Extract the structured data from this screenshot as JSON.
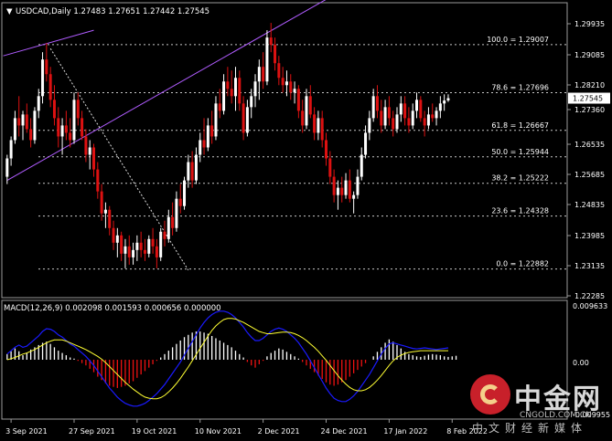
{
  "header": {
    "menu_glyph": "▼",
    "symbol_line": "USDCAD,Daily  1.27483 1.27651 1.27442 1.27545",
    "macd_line": "MACD(12,26,9) 0.002098 0.001593 0.000656 0.000000"
  },
  "colors": {
    "background": "#000000",
    "bull": "#ffffff",
    "bear": "#dd1111",
    "trendline": "#b05cff",
    "fib_line": "#c8c8c8",
    "macd_line": "#1a1aff",
    "signal_line": "#ffff33",
    "hist_pos": "#ffffff",
    "hist_neg": "#ee1111"
  },
  "chart_data": {
    "type": "candlestick",
    "symbol": "USDCAD",
    "timeframe": "Daily",
    "last_price_label": "1.27545",
    "ylim": [
      1.221,
      1.3015
    ],
    "price_ticks": [
      "1.29935",
      "1.29085",
      "1.28210",
      "1.27360",
      "1.26535",
      "1.25685",
      "1.24835",
      "1.23985",
      "1.23135",
      "1.22285"
    ],
    "x_ticks": [
      "3 Sep 2021",
      "27 Sep 2021",
      "19 Oct 2021",
      "10 Nov 2021",
      "2 Dec 2021",
      "24 Dec 2021",
      "17 Jan 2022",
      "8 Feb 2022"
    ],
    "x_tick_index": [
      1,
      17,
      33,
      49,
      65,
      81,
      97,
      113
    ],
    "candles": [
      [
        1.254,
        1.26,
        1.252,
        1.259
      ],
      [
        1.259,
        1.265,
        1.257,
        1.264
      ],
      [
        1.264,
        1.272,
        1.263,
        1.27
      ],
      [
        1.27,
        1.276,
        1.265,
        1.268
      ],
      [
        1.268,
        1.272,
        1.264,
        1.271
      ],
      [
        1.271,
        1.274,
        1.266,
        1.267
      ],
      [
        1.267,
        1.27,
        1.262,
        1.264
      ],
      [
        1.264,
        1.273,
        1.263,
        1.272
      ],
      [
        1.272,
        1.278,
        1.27,
        1.276
      ],
      [
        1.276,
        1.288,
        1.274,
        1.286
      ],
      [
        1.286,
        1.2905,
        1.28,
        1.282
      ],
      [
        1.282,
        1.284,
        1.273,
        1.275
      ],
      [
        1.275,
        1.279,
        1.268,
        1.27
      ],
      [
        1.27,
        1.273,
        1.262,
        1.265
      ],
      [
        1.265,
        1.27,
        1.26,
        1.268
      ],
      [
        1.268,
        1.272,
        1.264,
        1.266
      ],
      [
        1.266,
        1.27,
        1.262,
        1.264
      ],
      [
        1.264,
        1.277,
        1.263,
        1.275
      ],
      [
        1.275,
        1.277,
        1.268,
        1.27
      ],
      [
        1.27,
        1.272,
        1.264,
        1.265
      ],
      [
        1.265,
        1.267,
        1.258,
        1.26
      ],
      [
        1.26,
        1.264,
        1.256,
        1.262
      ],
      [
        1.262,
        1.263,
        1.254,
        1.256
      ],
      [
        1.256,
        1.258,
        1.248,
        1.25
      ],
      [
        1.25,
        1.252,
        1.242,
        1.244
      ],
      [
        1.244,
        1.247,
        1.24,
        1.245
      ],
      [
        1.245,
        1.246,
        1.238,
        1.24
      ],
      [
        1.24,
        1.242,
        1.234,
        1.236
      ],
      [
        1.236,
        1.24,
        1.232,
        1.238
      ],
      [
        1.238,
        1.239,
        1.231,
        1.233
      ],
      [
        1.233,
        1.237,
        1.229,
        1.235
      ],
      [
        1.235,
        1.238,
        1.23,
        1.232
      ],
      [
        1.232,
        1.236,
        1.23,
        1.234
      ],
      [
        1.234,
        1.238,
        1.231,
        1.236
      ],
      [
        1.236,
        1.239,
        1.232,
        1.234
      ],
      [
        1.234,
        1.237,
        1.231,
        1.233
      ],
      [
        1.233,
        1.238,
        1.232,
        1.237
      ],
      [
        1.237,
        1.24,
        1.233,
        1.235
      ],
      [
        1.235,
        1.237,
        1.229,
        1.232
      ],
      [
        1.232,
        1.24,
        1.231,
        1.239
      ],
      [
        1.239,
        1.242,
        1.235,
        1.237
      ],
      [
        1.237,
        1.245,
        1.236,
        1.243
      ],
      [
        1.243,
        1.247,
        1.238,
        1.24
      ],
      [
        1.24,
        1.25,
        1.239,
        1.248
      ],
      [
        1.248,
        1.252,
        1.244,
        1.246
      ],
      [
        1.246,
        1.254,
        1.245,
        1.253
      ],
      [
        1.253,
        1.26,
        1.251,
        1.258
      ],
      [
        1.258,
        1.261,
        1.251,
        1.253
      ],
      [
        1.253,
        1.262,
        1.252,
        1.26
      ],
      [
        1.26,
        1.266,
        1.258,
        1.264
      ],
      [
        1.264,
        1.27,
        1.26,
        1.262
      ],
      [
        1.262,
        1.27,
        1.261,
        1.268
      ],
      [
        1.268,
        1.272,
        1.263,
        1.265
      ],
      [
        1.265,
        1.276,
        1.264,
        1.274
      ],
      [
        1.274,
        1.278,
        1.27,
        1.272
      ],
      [
        1.272,
        1.282,
        1.271,
        1.28
      ],
      [
        1.28,
        1.284,
        1.276,
        1.278
      ],
      [
        1.278,
        1.283,
        1.274,
        1.276
      ],
      [
        1.276,
        1.284,
        1.272,
        1.281
      ],
      [
        1.281,
        1.283,
        1.272,
        1.274
      ],
      [
        1.274,
        1.276,
        1.264,
        1.266
      ],
      [
        1.266,
        1.275,
        1.265,
        1.273
      ],
      [
        1.273,
        1.278,
        1.27,
        1.276
      ],
      [
        1.276,
        1.282,
        1.273,
        1.28
      ],
      [
        1.28,
        1.286,
        1.275,
        1.284
      ],
      [
        1.284,
        1.288,
        1.278,
        1.28
      ],
      [
        1.28,
        1.294,
        1.279,
        1.292
      ],
      [
        1.292,
        1.296,
        1.288,
        1.29
      ],
      [
        1.29,
        1.292,
        1.283,
        1.285
      ],
      [
        1.285,
        1.287,
        1.279,
        1.281
      ],
      [
        1.281,
        1.284,
        1.277,
        1.279
      ],
      [
        1.279,
        1.283,
        1.276,
        1.28
      ],
      [
        1.28,
        1.282,
        1.275,
        1.277
      ],
      [
        1.277,
        1.28,
        1.274,
        1.278
      ],
      [
        1.278,
        1.279,
        1.27,
        1.272
      ],
      [
        1.272,
        1.275,
        1.266,
        1.268
      ],
      [
        1.268,
        1.278,
        1.267,
        1.276
      ],
      [
        1.276,
        1.279,
        1.27,
        1.271
      ],
      [
        1.271,
        1.273,
        1.264,
        1.266
      ],
      [
        1.266,
        1.272,
        1.264,
        1.27
      ],
      [
        1.27,
        1.272,
        1.262,
        1.264
      ],
      [
        1.264,
        1.266,
        1.257,
        1.259
      ],
      [
        1.259,
        1.261,
        1.252,
        1.254
      ],
      [
        1.254,
        1.256,
        1.247,
        1.249
      ],
      [
        1.249,
        1.253,
        1.245,
        1.251
      ],
      [
        1.251,
        1.254,
        1.247,
        1.249
      ],
      [
        1.249,
        1.255,
        1.248,
        1.253
      ],
      [
        1.253,
        1.256,
        1.247,
        1.248
      ],
      [
        1.248,
        1.25,
        1.244,
        1.249
      ],
      [
        1.249,
        1.256,
        1.248,
        1.254
      ],
      [
        1.254,
        1.262,
        1.253,
        1.26
      ],
      [
        1.26,
        1.268,
        1.259,
        1.266
      ],
      [
        1.266,
        1.272,
        1.264,
        1.27
      ],
      [
        1.27,
        1.278,
        1.269,
        1.276
      ],
      [
        1.276,
        1.279,
        1.27,
        1.272
      ],
      [
        1.272,
        1.275,
        1.266,
        1.268
      ],
      [
        1.268,
        1.275,
        1.267,
        1.273
      ],
      [
        1.273,
        1.276,
        1.268,
        1.27
      ],
      [
        1.27,
        1.272,
        1.265,
        1.267
      ],
      [
        1.267,
        1.273,
        1.266,
        1.271
      ],
      [
        1.271,
        1.276,
        1.269,
        1.274
      ],
      [
        1.274,
        1.276,
        1.268,
        1.27
      ],
      [
        1.27,
        1.273,
        1.266,
        1.268
      ],
      [
        1.268,
        1.274,
        1.267,
        1.272
      ],
      [
        1.272,
        1.277,
        1.27,
        1.275
      ],
      [
        1.275,
        1.276,
        1.269,
        1.27
      ],
      [
        1.27,
        1.272,
        1.265,
        1.268
      ],
      [
        1.268,
        1.273,
        1.267,
        1.271
      ],
      [
        1.271,
        1.274,
        1.269,
        1.27
      ],
      [
        1.27,
        1.273,
        1.268,
        1.272
      ],
      [
        1.272,
        1.276,
        1.27,
        1.274
      ],
      [
        1.274,
        1.2765,
        1.272,
        1.2748
      ],
      [
        1.27483,
        1.27651,
        1.27442,
        1.27545
      ]
    ],
    "fib_levels": [
      {
        "label": "100.0 = 1.29007",
        "price": 1.29007
      },
      {
        "label": "78.6 = 1.27696",
        "price": 1.27696
      },
      {
        "label": "61.8 = 1.26667",
        "price": 1.26667
      },
      {
        "label": "50.0 = 1.25944",
        "price": 1.25944
      },
      {
        "label": "38.2 = 1.25222",
        "price": 1.25222
      },
      {
        "label": "23.6 = 1.24328",
        "price": 1.24328
      },
      {
        "label": "0.0 = 1.22882",
        "price": 1.22882
      }
    ],
    "trendlines": [
      {
        "style": "solid",
        "points": [
          [
            -1,
            1.287
          ],
          [
            22,
            1.294
          ]
        ]
      },
      {
        "style": "solid",
        "points": [
          [
            0,
            1.253
          ],
          [
            100,
            1.314
          ]
        ]
      },
      {
        "style": "dotted",
        "points": [
          [
            11,
            1.289
          ],
          [
            46,
            1.2285
          ]
        ]
      }
    ],
    "macd": {
      "name": "MACD(12,26,9)",
      "ylim": [
        -0.0105,
        0.0105
      ],
      "tick_labels": [
        "0.009633",
        "0.00",
        "-0.009955"
      ],
      "histogram": [
        0.001,
        0.0015,
        0.002,
        0.0015,
        0.0008,
        0.0012,
        0.0018,
        0.0022,
        0.0026,
        0.003,
        0.0032,
        0.0028,
        0.0022,
        0.0016,
        0.0012,
        0.0008,
        0.0004,
        0.0002,
        -0.0002,
        -0.0006,
        -0.001,
        -0.0016,
        -0.0022,
        -0.003,
        -0.0036,
        -0.0042,
        -0.0046,
        -0.0048,
        -0.005,
        -0.0048,
        -0.0046,
        -0.0042,
        -0.0038,
        -0.0032,
        -0.0026,
        -0.002,
        -0.0014,
        -0.0008,
        -0.0002,
        0.0004,
        0.001,
        0.0016,
        0.0022,
        0.0028,
        0.0034,
        0.004,
        0.0044,
        0.0048,
        0.005,
        0.005,
        0.0048,
        0.0046,
        0.0042,
        0.0038,
        0.0034,
        0.003,
        0.0026,
        0.0022,
        0.0016,
        0.001,
        0.0004,
        -0.0004,
        -0.001,
        -0.0014,
        -0.0008,
        -0.0002,
        0.0006,
        0.0012,
        0.0016,
        0.002,
        0.0018,
        0.0014,
        0.001,
        0.0006,
        0.0002,
        -0.0004,
        -0.001,
        -0.0016,
        -0.0022,
        -0.0028,
        -0.0034,
        -0.004,
        -0.0044,
        -0.0046,
        -0.0044,
        -0.004,
        -0.0036,
        -0.003,
        -0.0024,
        -0.0018,
        -0.0012,
        -0.0006,
        0.0,
        0.0006,
        0.0014,
        0.0022,
        0.003,
        0.0036,
        0.0032,
        0.0026,
        0.002,
        0.0014,
        0.001,
        0.0008,
        0.0006,
        0.0005,
        0.0007,
        0.0009,
        0.001,
        0.0009,
        0.0008,
        0.0006,
        0.0005,
        0.0006,
        0.0007
      ],
      "macd": [
        0.001,
        0.0016,
        0.0022,
        0.0026,
        0.0022,
        0.0024,
        0.003,
        0.0036,
        0.0042,
        0.005,
        0.0055,
        0.0054,
        0.005,
        0.0044,
        0.004,
        0.0034,
        0.0028,
        0.0024,
        0.0018,
        0.0012,
        0.0006,
        -0.0002,
        -0.001,
        -0.002,
        -0.003,
        -0.004,
        -0.005,
        -0.0058,
        -0.0066,
        -0.0072,
        -0.0077,
        -0.008,
        -0.0082,
        -0.0082,
        -0.008,
        -0.0077,
        -0.0072,
        -0.0066,
        -0.006,
        -0.0052,
        -0.0044,
        -0.0034,
        -0.0024,
        -0.0014,
        -0.0004,
        0.0008,
        0.002,
        0.0032,
        0.0044,
        0.0056,
        0.0066,
        0.0074,
        0.008,
        0.0084,
        0.0086,
        0.0086,
        0.0084,
        0.008,
        0.0074,
        0.0066,
        0.0058,
        0.0048,
        0.004,
        0.0034,
        0.0034,
        0.0038,
        0.0044,
        0.005,
        0.0054,
        0.0056,
        0.0054,
        0.005,
        0.0044,
        0.0038,
        0.003,
        0.002,
        0.001,
        -0.0002,
        -0.0014,
        -0.0026,
        -0.0038,
        -0.005,
        -0.006,
        -0.0068,
        -0.0072,
        -0.0074,
        -0.0074,
        -0.007,
        -0.0064,
        -0.0056,
        -0.0046,
        -0.0036,
        -0.0026,
        -0.0014,
        -0.0002,
        0.001,
        0.002,
        0.0028,
        0.003,
        0.0028,
        0.0026,
        0.0024,
        0.0022,
        0.002,
        0.0019,
        0.002,
        0.0021,
        0.002,
        0.0019,
        0.0018,
        0.0019,
        0.002,
        0.0021
      ],
      "signal": [
        0.0,
        0.0002,
        0.0004,
        0.0007,
        0.001,
        0.0012,
        0.0015,
        0.0018,
        0.0022,
        0.0026,
        0.003,
        0.0033,
        0.0035,
        0.0035,
        0.0035,
        0.0033,
        0.003,
        0.0027,
        0.0024,
        0.0021,
        0.0018,
        0.0014,
        0.001,
        0.0006,
        0.0001,
        -0.0005,
        -0.0012,
        -0.0019,
        -0.0026,
        -0.0033,
        -0.004,
        -0.0046,
        -0.0052,
        -0.0057,
        -0.0062,
        -0.0066,
        -0.0068,
        -0.0069,
        -0.0069,
        -0.0067,
        -0.0063,
        -0.0057,
        -0.005,
        -0.0042,
        -0.0033,
        -0.0023,
        -0.0013,
        -0.0002,
        0.0009,
        0.002,
        0.0031,
        0.0042,
        0.0052,
        0.006,
        0.0066,
        0.0071,
        0.0073,
        0.0073,
        0.0072,
        0.0069,
        0.0066,
        0.0062,
        0.0058,
        0.0054,
        0.005,
        0.0048,
        0.0046,
        0.0046,
        0.0047,
        0.0048,
        0.0049,
        0.0049,
        0.0048,
        0.0046,
        0.0043,
        0.0039,
        0.0034,
        0.0028,
        0.0022,
        0.0015,
        0.0007,
        -0.0001,
        -0.001,
        -0.0019,
        -0.0028,
        -0.0036,
        -0.0043,
        -0.0049,
        -0.0053,
        -0.0055,
        -0.0055,
        -0.0053,
        -0.0049,
        -0.0043,
        -0.0036,
        -0.0028,
        -0.0019,
        -0.001,
        -0.0002,
        0.0004,
        0.0008,
        0.0011,
        0.0013,
        0.0014,
        0.0015,
        0.0016,
        0.0016,
        0.0016,
        0.0016,
        0.0016,
        0.0016,
        0.0016,
        0.0016
      ]
    }
  },
  "watermark": {
    "brand": "中金网",
    "domain": "CNGOLD.COM.CN",
    "tagline": "中文财经新媒体"
  }
}
